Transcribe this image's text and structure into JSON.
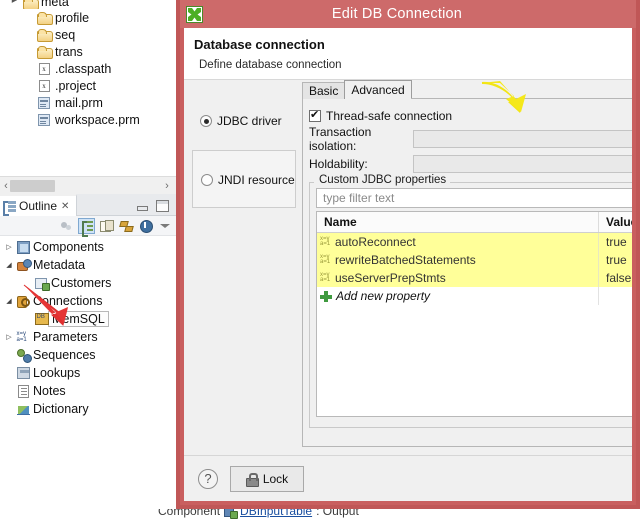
{
  "explorer": {
    "items": [
      {
        "label": "meta",
        "icon": "folder-icon",
        "twisty": "collapsed",
        "indent": 0,
        "clipped": true
      },
      {
        "label": "profile",
        "icon": "folder-icon",
        "twisty": "none",
        "indent": 1
      },
      {
        "label": "seq",
        "icon": "folder-icon",
        "twisty": "none",
        "indent": 1
      },
      {
        "label": "trans",
        "icon": "folder-icon",
        "twisty": "none",
        "indent": 1
      },
      {
        "label": ".classpath",
        "icon": "xml-file-icon",
        "twisty": "none",
        "indent": 1
      },
      {
        "label": ".project",
        "icon": "xml-file-icon",
        "twisty": "none",
        "indent": 1
      },
      {
        "label": "mail.prm",
        "icon": "prm-file-icon",
        "twisty": "none",
        "indent": 1
      },
      {
        "label": "workspace.prm",
        "icon": "prm-file-icon",
        "twisty": "none",
        "indent": 1
      }
    ],
    "scrollbar": {
      "left_arrow": "‹",
      "right_arrow": "›"
    }
  },
  "outline": {
    "tab_label": "Outline",
    "tab_close": "✕",
    "toolbar_icons": [
      "link-with-editor-icon",
      "show-structure-icon",
      "show-properties-icon",
      "sort-icon",
      "info-icon",
      "view-menu-caret-icon"
    ],
    "items": [
      {
        "label": "Components",
        "icon": "components-icon",
        "twisty": "collapsed",
        "indent": 0,
        "selected": false
      },
      {
        "label": "Metadata",
        "icon": "metadata-icon",
        "twisty": "expanded",
        "indent": 0,
        "selected": false
      },
      {
        "label": "Customers",
        "icon": "customers-icon",
        "twisty": "none",
        "indent": 1,
        "selected": false
      },
      {
        "label": "Connections",
        "icon": "connections-icon",
        "twisty": "expanded",
        "indent": 0,
        "selected": false
      },
      {
        "label": "MemSQL",
        "icon": "db-connection-icon",
        "twisty": "none",
        "indent": 1,
        "selected": true
      },
      {
        "label": "Parameters",
        "icon": "parameters-icon",
        "twisty": "collapsed",
        "indent": 0,
        "selected": false
      },
      {
        "label": "Sequences",
        "icon": "sequences-icon",
        "twisty": "none",
        "indent": 0,
        "selected": false
      },
      {
        "label": "Lookups",
        "icon": "lookups-icon",
        "twisty": "none",
        "indent": 0,
        "selected": false
      },
      {
        "label": "Notes",
        "icon": "notes-icon",
        "twisty": "none",
        "indent": 0,
        "selected": false
      },
      {
        "label": "Dictionary",
        "icon": "dictionary-icon",
        "twisty": "none",
        "indent": 0,
        "selected": false
      }
    ]
  },
  "annotations": {
    "red_arrow": {
      "color": "#e03030",
      "points_to": "MemSQL"
    },
    "yellow_arrow": {
      "color": "#f2e515",
      "points_to": "Advanced tab"
    }
  },
  "dialog": {
    "title": "Edit DB Connection",
    "app_icon": "cloveretl-icon",
    "titlebar_color": "#cd6a6a",
    "header_title": "Database connection",
    "header_subtitle": "Define database connection",
    "connection_type": {
      "options": [
        {
          "label": "JDBC driver",
          "selected": true
        },
        {
          "label": "JNDI resource",
          "selected": false
        }
      ]
    },
    "tabs": [
      {
        "label": "Basic",
        "active": false
      },
      {
        "label": "Advanced",
        "active": true
      }
    ],
    "advanced": {
      "thread_safe": {
        "label": "Thread-safe connection",
        "checked": true
      },
      "fields": [
        {
          "label": "Transaction isolation:",
          "value": "",
          "enabled": false
        },
        {
          "label": "Holdability:",
          "value": "",
          "enabled": false
        }
      ],
      "group_title": "Custom JDBC properties",
      "filter_placeholder": "type filter text",
      "filter_value": "",
      "table": {
        "columns": [
          "Name",
          "Value"
        ],
        "rows": [
          {
            "name": "autoReconnect",
            "value": "true",
            "icon": "property-variable-icon",
            "highlight": "#ffff99"
          },
          {
            "name": "rewriteBatchedStatements",
            "value": "true",
            "icon": "property-variable-icon",
            "highlight": "#ffff99"
          },
          {
            "name": "useServerPrepStmts",
            "value": "false",
            "icon": "property-variable-icon",
            "highlight": "#ffff99"
          }
        ],
        "add_row": {
          "label": "Add new property",
          "icon": "plus-icon"
        }
      }
    },
    "footer": {
      "help_label": "?",
      "lock_label": "Lock",
      "lock_icon": "lock-icon"
    }
  },
  "status_bar": {
    "prefix": "Component",
    "icon": "component-icon",
    "link": "DBInputTable",
    "suffix": ": Output"
  }
}
